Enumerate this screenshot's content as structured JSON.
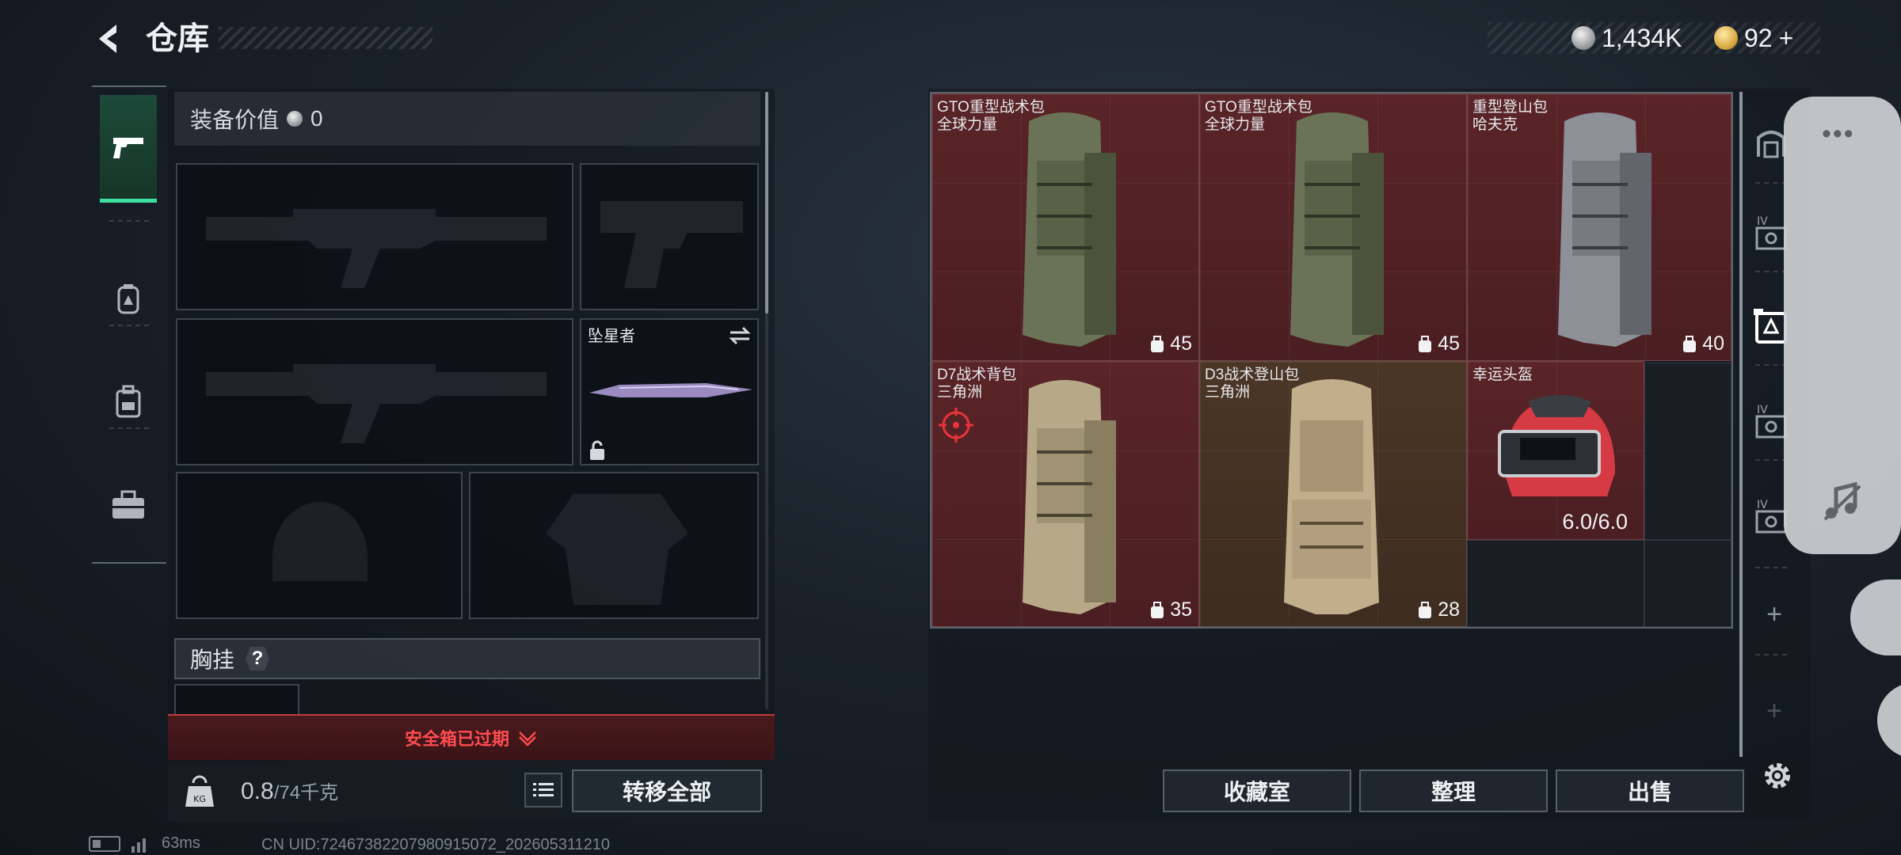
{
  "header": {
    "title": "仓库",
    "currency_silver": "1,434K",
    "currency_gold": "92",
    "currency_gold_add": "+"
  },
  "left_nav": {
    "items": [
      {
        "icon": "pistol-icon",
        "active": true
      },
      {
        "icon": "backpack-icon",
        "active": false
      },
      {
        "icon": "vest-icon",
        "active": false
      },
      {
        "icon": "briefcase-icon",
        "active": false
      }
    ]
  },
  "equipment": {
    "value_label": "装备价值",
    "value": "0",
    "melee_name": "坠星者",
    "section_label": "胸挂",
    "help_label": "?"
  },
  "safe_box": {
    "status": "安全箱已过期",
    "weight_current": "0.8",
    "weight_max": "/74千克",
    "transfer_all": "转移全部"
  },
  "storage": {
    "items": [
      {
        "name": "GTO重型战术包",
        "brand": "全球力量",
        "capacity": "45",
        "color": "red"
      },
      {
        "name": "GTO重型战术包",
        "brand": "全球力量",
        "capacity": "45",
        "color": "red"
      },
      {
        "name": "重型登山包",
        "brand": "哈夫克",
        "capacity": "40",
        "color": "red"
      },
      {
        "name": "D7战术背包",
        "brand": "三角洲",
        "capacity": "35",
        "color": "red"
      },
      {
        "name": "D3战术登山包",
        "brand": "三角洲",
        "capacity": "28",
        "color": "brown"
      },
      {
        "name": "幸运头盔",
        "durability": "6.0/6.0",
        "color": "red"
      }
    ],
    "actions": {
      "collection": "收藏室",
      "organize": "整理",
      "sell": "出售"
    },
    "plus": "+"
  },
  "overlay": {
    "menu_dots": "•••"
  },
  "status_bar": {
    "ping": "63ms",
    "uid": "CN UID:7246738220798091​5072_202605311210"
  },
  "colors": {
    "accent_green": "#3de0a0",
    "item_red": "#5a2428",
    "item_brown": "#4b3626",
    "warning_red": "#ff4c50"
  }
}
